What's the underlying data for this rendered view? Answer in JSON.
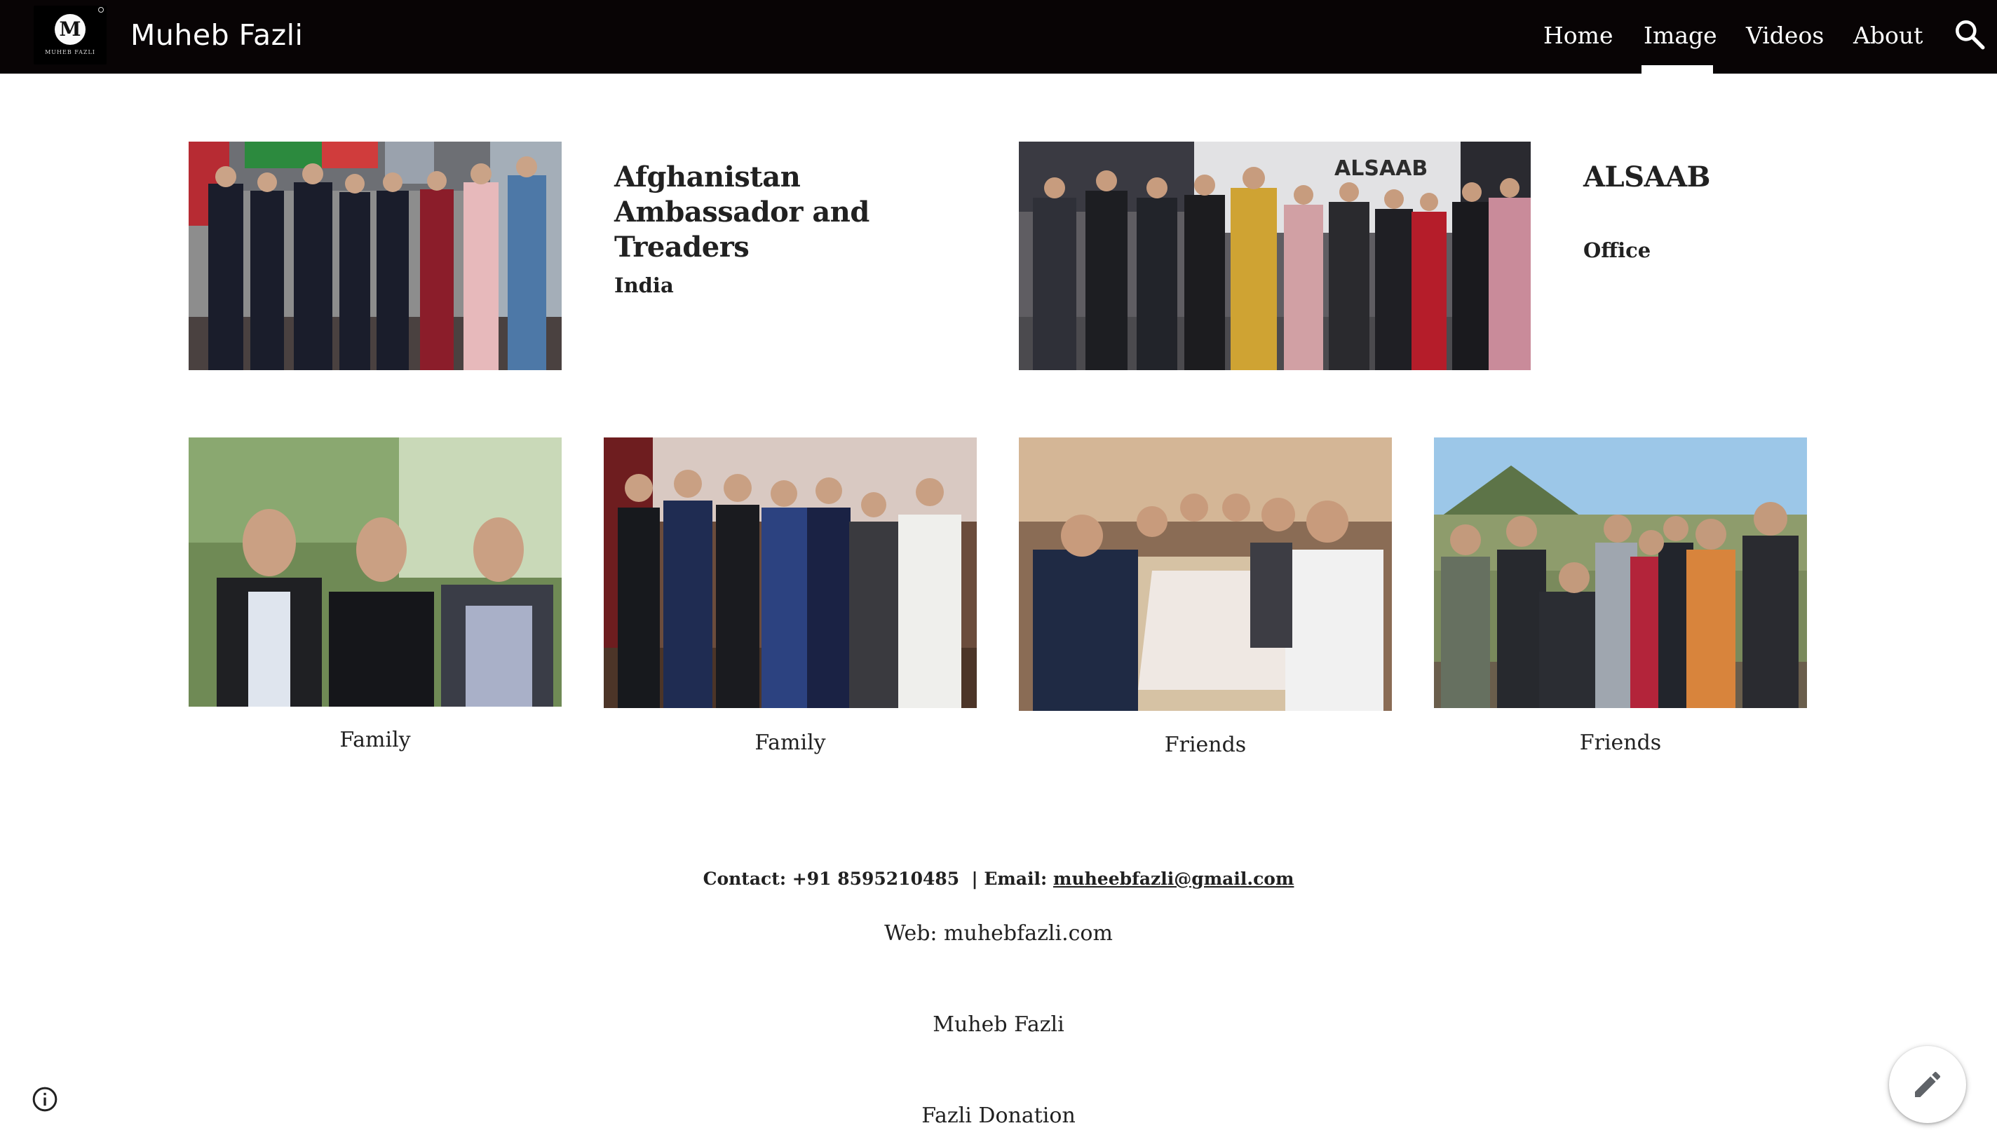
{
  "header": {
    "logo": {
      "letter": "M",
      "subtext": "MUHEB FAZLI"
    },
    "site_title": "Muheb Fazli",
    "nav": [
      {
        "label": "Home",
        "active": false
      },
      {
        "label": "Image",
        "active": true
      },
      {
        "label": "Videos",
        "active": false
      },
      {
        "label": "About",
        "active": false
      }
    ],
    "search_icon": "search-icon"
  },
  "featured": [
    {
      "title": "Afghanistan Ambassador and Treaders",
      "subtitle": "India",
      "photo_desc": "group-photo"
    },
    {
      "title": "ALSAAB",
      "subtitle": "Office",
      "photo_sign": "ALSAAB"
    }
  ],
  "gallery": [
    {
      "caption": "Family"
    },
    {
      "caption": "Family"
    },
    {
      "caption": "Friends"
    },
    {
      "caption": "Friends"
    }
  ],
  "footer": {
    "contact_label": "Contact: +91 8595210485  | Email: ",
    "email": "muheebfazli@gmail.com",
    "web": "Web: muhebfazli.com",
    "owner": "Muheb Fazli",
    "donation": "Fazli Donation"
  },
  "colors": {
    "header_bg": "#080405",
    "text": "#212121",
    "background": "#ffffff"
  },
  "icons": {
    "info": "info-icon",
    "edit": "pencil-icon"
  }
}
